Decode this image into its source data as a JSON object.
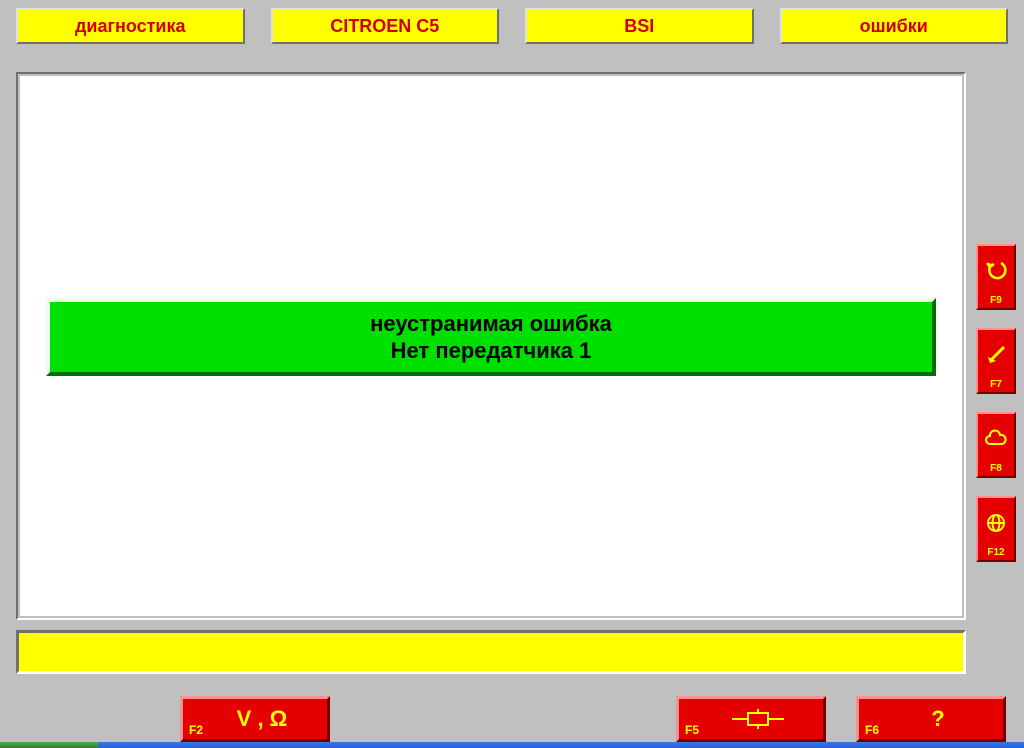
{
  "crumbs": [
    "диагностика",
    "CITROEN C5",
    "BSI",
    "ошибки"
  ],
  "error": {
    "line1": "неустранимая ошибка",
    "line2": "Нет передатчика 1"
  },
  "side_keys": [
    {
      "key": "F9",
      "icon": "undo-icon"
    },
    {
      "key": "F7",
      "icon": "pointer-icon"
    },
    {
      "key": "F8",
      "icon": "cloud-icon"
    },
    {
      "key": "F12",
      "icon": "globe-icon"
    }
  ],
  "bottom_keys": {
    "f2": {
      "key": "F2",
      "label": "V , Ω"
    },
    "f5": {
      "key": "F5"
    },
    "f6": {
      "key": "F6",
      "label": "?"
    }
  }
}
